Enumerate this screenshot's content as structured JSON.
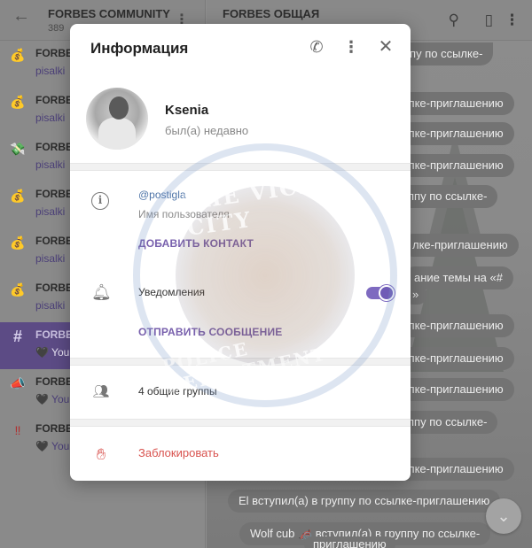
{
  "sidebar": {
    "title": "FORBES COMMUNITY",
    "member_count": "389",
    "chats": [
      {
        "icon": "money-bag",
        "glyph": "💰",
        "name": "FORBE",
        "sub": "pisalki"
      },
      {
        "icon": "money-bag",
        "glyph": "💰",
        "name": "FORBE",
        "sub": "pisalki"
      },
      {
        "icon": "money-with-wings",
        "glyph": "💸",
        "name": "FORBE",
        "sub": "pisalki"
      },
      {
        "icon": "money-bag",
        "glyph": "💰",
        "name": "FORBE",
        "sub": "pisalki"
      },
      {
        "icon": "money-bag",
        "glyph": "💰",
        "name": "FORBE",
        "sub": "pisalki"
      },
      {
        "icon": "money-bag",
        "glyph": "💰",
        "name": "FORBE",
        "sub": "pisalki"
      },
      {
        "icon": "hash",
        "glyph": "#",
        "name": "FORBE",
        "sub": "🖤 You"
      },
      {
        "icon": "megaphone",
        "glyph": "📣",
        "name": "FORBE",
        "sub": "🖤 You"
      },
      {
        "icon": "double-exclamation",
        "glyph": "‼",
        "name": "FORBE",
        "sub": "🖤 You"
      }
    ]
  },
  "chat": {
    "title": "FORBES ОБЩАЯ",
    "bubbles": [
      "ппу по ссылке-",
      "лке-приглашению",
      "лке-приглашению",
      "лке-приглашению",
      "ппу по ссылке-",
      "лке-приглашению",
      "ание темы на «#",
      "»",
      "лке-приглашению",
      "лке-приглашению",
      "лке-приглашению",
      "ппу по ссылке-",
      "лке-приглашению",
      "El вступил(а) в группу по ссылке-приглашению",
      "Wolf cub 🦽 вступил(а) в группу по ссылке-",
      "приглашению"
    ]
  },
  "modal": {
    "title": "Информация",
    "name": "Ksenia",
    "status": "был(а) недавно",
    "username": "@postigla",
    "username_label": "Имя пользователя",
    "add_contact": "ДОБАВИТЬ КОНТАКТ",
    "notifications_label": "Уведомления",
    "notifications_on": true,
    "send_message": "ОТПРАВИТЬ СООБЩЕНИЕ",
    "common_groups": "4 общие группы",
    "block": "Заблокировать"
  },
  "watermark": {
    "top_text": "THE VICE CITY",
    "bottom_text": "POLICE DEPARTMENT"
  },
  "colors": {
    "accent": "#7860ad",
    "link": "#4f75a8",
    "danger": "#d9534f",
    "active_chat": "#5c4b85"
  }
}
